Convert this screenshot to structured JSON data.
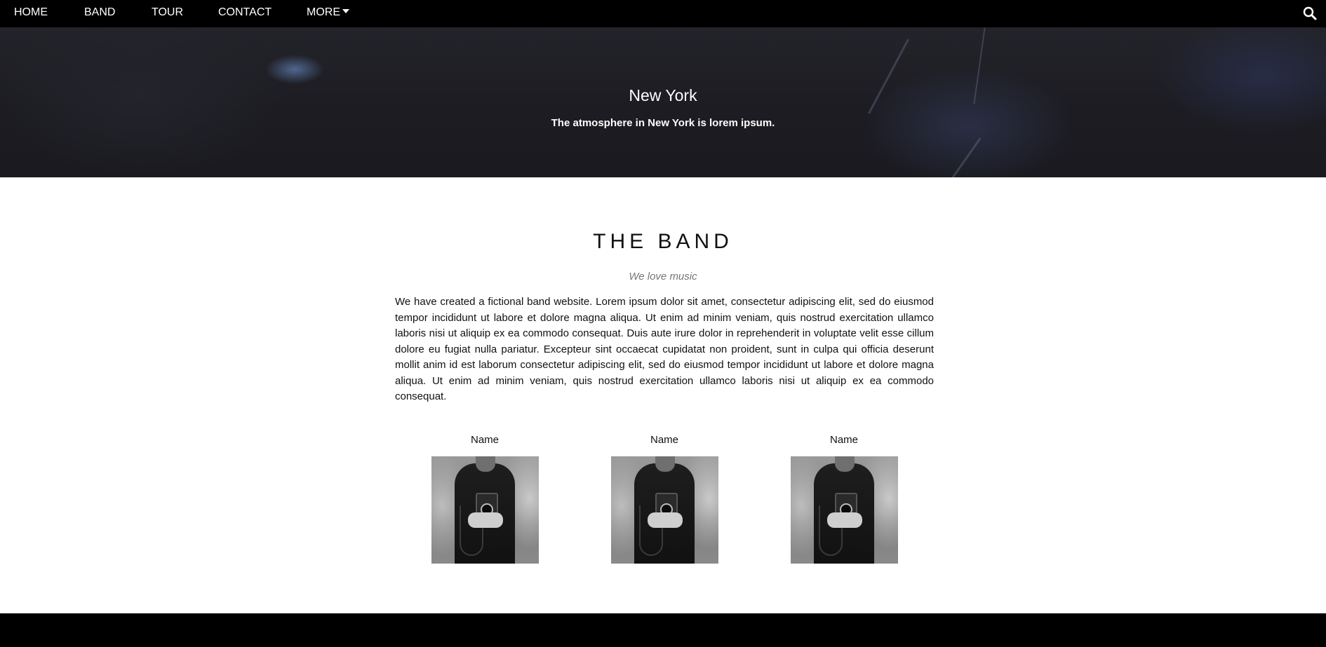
{
  "nav": {
    "items": [
      {
        "label": "HOME"
      },
      {
        "label": "BAND"
      },
      {
        "label": "TOUR"
      },
      {
        "label": "CONTACT"
      },
      {
        "label": "MORE",
        "icon": "caret-down-icon"
      }
    ],
    "search_icon": "search-icon"
  },
  "hero": {
    "title": "New York",
    "subtitle": "The atmosphere in New York is lorem ipsum."
  },
  "band": {
    "title": "THE BAND",
    "tagline": "We love music",
    "description": "We have created a fictional band website. Lorem ipsum dolor sit amet, consectetur adipiscing elit, sed do eiusmod tempor incididunt ut labore et dolore magna aliqua. Ut enim ad minim veniam, quis nostrud exercitation ullamco laboris nisi ut aliquip ex ea commodo consequat. Duis aute irure dolor in reprehenderit in voluptate velit esse cillum dolore eu fugiat nulla pariatur. Excepteur sint occaecat cupidatat non proident, sunt in culpa qui officia deserunt mollit anim id est laborum consectetur adipiscing elit, sed do eiusmod tempor incididunt ut labore et dolore magna aliqua. Ut enim ad minim veniam, quis nostrud exercitation ullamco laboris nisi ut aliquip ex ea commodo consequat.",
    "members": [
      {
        "name": "Name"
      },
      {
        "name": "Name"
      },
      {
        "name": "Name"
      }
    ]
  },
  "colors": {
    "nav_bg": "#000000",
    "footer_bg": "#000000",
    "text": "#111111",
    "tagline": "#777777"
  }
}
